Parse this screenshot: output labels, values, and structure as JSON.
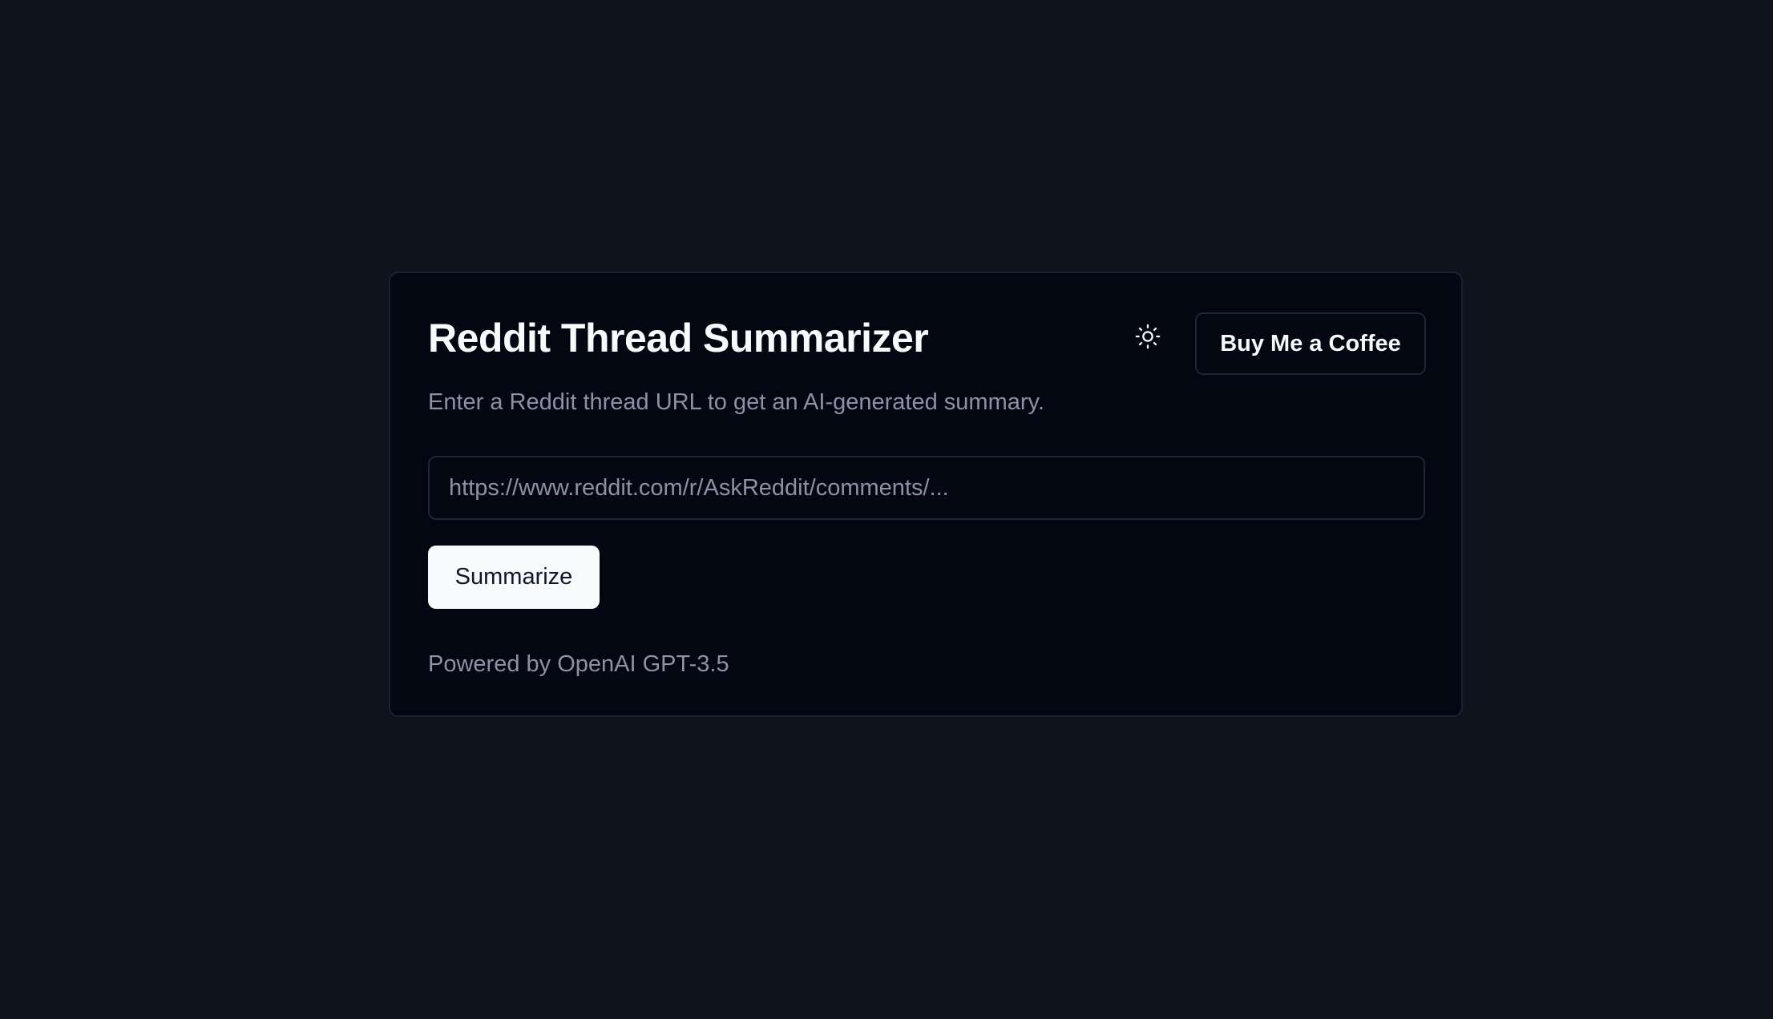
{
  "app": {
    "title": "Reddit Thread Summarizer",
    "subtitle": "Enter a Reddit thread URL to get an AI-generated summary."
  },
  "header": {
    "theme_toggle_icon": "sun-icon",
    "coffee_button_label": "Buy Me a Coffee"
  },
  "form": {
    "url_input_value": "",
    "url_input_placeholder": "https://www.reddit.com/r/AskReddit/comments/...",
    "submit_label": "Summarize"
  },
  "footer": {
    "powered_by": "Powered by OpenAI GPT-3.5"
  },
  "colors": {
    "page_background": "#0f131d",
    "card_background": "#030712",
    "border": "#1c2130",
    "primary_text": "#f8fafc",
    "muted_text": "#8a93a6",
    "primary_button_bg": "#f8fafc",
    "primary_button_text": "#0f172a"
  }
}
